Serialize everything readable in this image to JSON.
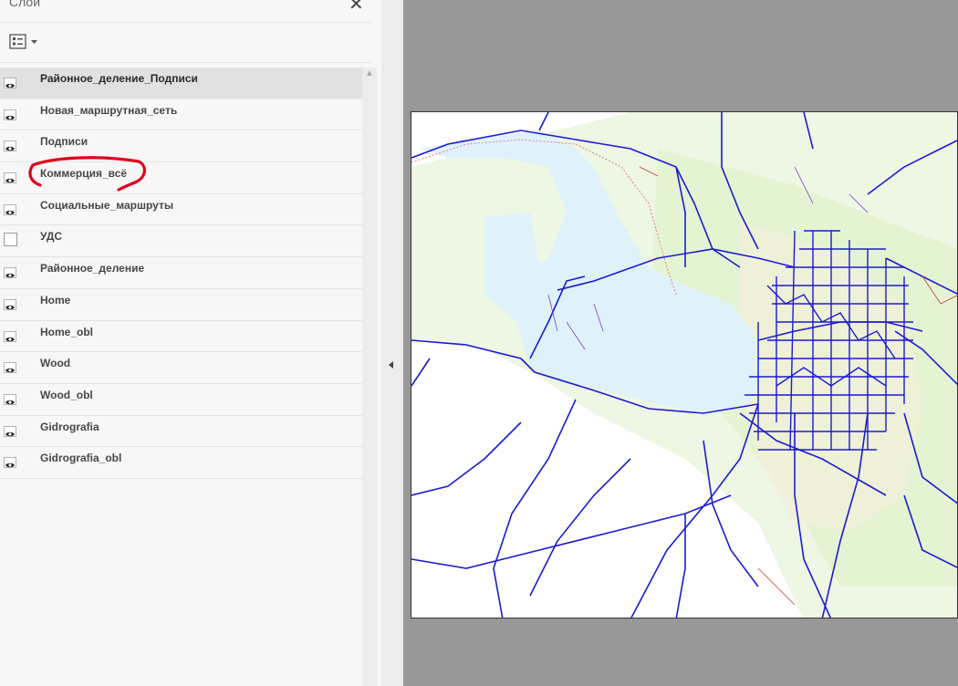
{
  "panel": {
    "title": "Слои",
    "close_glyph": "✕",
    "legend_icon": "legend-list-icon",
    "layers": [
      {
        "name": "Районное_деление_Подписи",
        "visible": true,
        "selected": true
      },
      {
        "name": "Новая_маршрутная_сеть",
        "visible": true
      },
      {
        "name": "Подписи",
        "visible": true
      },
      {
        "name": "Коммерция_всё",
        "visible": true,
        "highlighted": true
      },
      {
        "name": "Социальные_маршруты",
        "visible": true
      },
      {
        "name": "УДС",
        "visible": false
      },
      {
        "name": "Районное_деление",
        "visible": true
      },
      {
        "name": "Home",
        "visible": true
      },
      {
        "name": "Home_obl",
        "visible": true
      },
      {
        "name": "Wood",
        "visible": true
      },
      {
        "name": "Wood_obl",
        "visible": true
      },
      {
        "name": "Gidrografia",
        "visible": true
      },
      {
        "name": "Gidrografia_obl",
        "visible": true
      }
    ]
  },
  "colors": {
    "water": "#dff2fa",
    "land_green": "#e4f4d2",
    "routes": "#1b1bd0",
    "annotation": "#e0001a"
  }
}
